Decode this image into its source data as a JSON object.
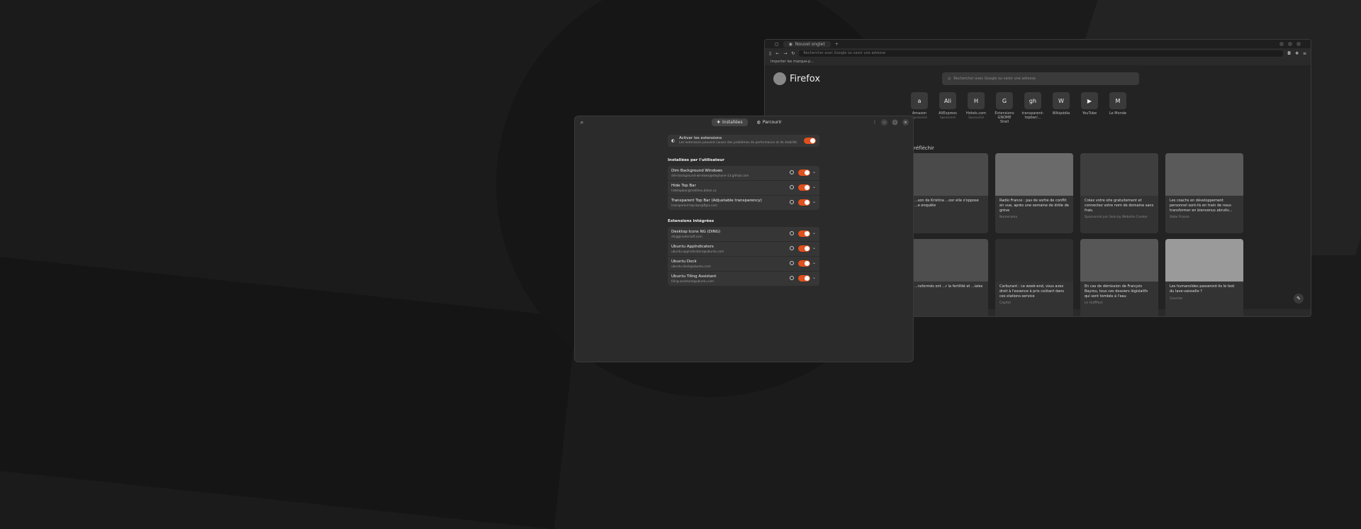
{
  "firefox": {
    "tab_title": "Nouvel onglet",
    "url_placeholder": "Rechercher avec Google ou saisir une adresse",
    "bookmark": "Importer les marque-p...",
    "brand": "Firefox",
    "search_placeholder": "Rechercher avec Google ou saisir une adresse",
    "shortcuts": [
      {
        "label": "Amazon",
        "sub": "Sponsorisé",
        "glyph": "a"
      },
      {
        "label": "AliExpress",
        "sub": "Sponsorisé",
        "glyph": "Ali"
      },
      {
        "label": "Hotels.com",
        "sub": "Sponsorisé",
        "glyph": "H"
      },
      {
        "label": "Extensions GNOME Shell",
        "sub": "",
        "glyph": "G"
      },
      {
        "label": "transparent-topbar/...",
        "sub": "",
        "glyph": "gh"
      },
      {
        "label": "Wikipédia",
        "sub": "",
        "glyph": "W"
      },
      {
        "label": "YouTube",
        "sub": "",
        "glyph": "▶"
      },
      {
        "label": "Le Monde",
        "sub": "",
        "glyph": "M"
      }
    ],
    "pocket_label": "réfléchir",
    "cards": [
      {
        "text": "...son de Kristina ...oor elle s'oppose ...e enquête",
        "source": ""
      },
      {
        "text": "Radio France : pas de sortie de conflit en vue, après une semaine de drôle de grève",
        "source": "Numerama"
      },
      {
        "text": "Créez votre site gratuitement et connectez votre nom de domaine sans frais.",
        "source": "Sponsorisé par Solo by Website Creator"
      },
      {
        "text": "Les coachs en développement personnel sont-ils en train de nous transformer en bienvenus abrutis...",
        "source": "Slate France"
      },
      {
        "text": "...nsformés ont ...r la fertilité et ...iales",
        "source": ""
      },
      {
        "text": "Carburant : ce week-end, vous avez droit à l'essence à prix coûtant dans ces stations-service",
        "source": "Capital"
      },
      {
        "text": "En cas de démission de François Bayrou, tous ces dossiers législatifs qui sont tombés à l'eau",
        "source": "Le HuffPost"
      },
      {
        "text": "Les humanoïdes passeront-ils le test du lave-vaisselle ?",
        "source": "Courrier"
      }
    ]
  },
  "extensions": {
    "tabs": [
      {
        "label": "Installées",
        "icon": "puzzle-icon"
      },
      {
        "label": "Parcourir",
        "icon": "globe-icon"
      }
    ],
    "master": {
      "title": "Activer les extensions",
      "subtitle": "Les extensions peuvent causer des problèmes de performance et de stabilité"
    },
    "user_section": "Installées par l'utilisateur",
    "user_extensions": [
      {
        "name": "Dim Background Windows",
        "uuid": "dim-background-windows@stephane-13.github.com"
      },
      {
        "name": "Hide Top Bar",
        "uuid": "hidetopbar@mathieu.bidon.ca"
      },
      {
        "name": "Transparent Top Bar (Adjustable transparency)",
        "uuid": "transparent-top-bar@ftpix.com"
      }
    ],
    "builtin_section": "Extensions intégrées",
    "builtin_extensions": [
      {
        "name": "Desktop Icons NG (DING)",
        "uuid": "ding@rastersoft.com"
      },
      {
        "name": "Ubuntu AppIndicators",
        "uuid": "ubuntu-appindicators@ubuntu.com"
      },
      {
        "name": "Ubuntu Dock",
        "uuid": "ubuntu-dock@ubuntu.com"
      },
      {
        "name": "Ubuntu Tiling Assistant",
        "uuid": "tiling-assistant@ubuntu.com"
      }
    ],
    "accent": "#e0501e"
  }
}
